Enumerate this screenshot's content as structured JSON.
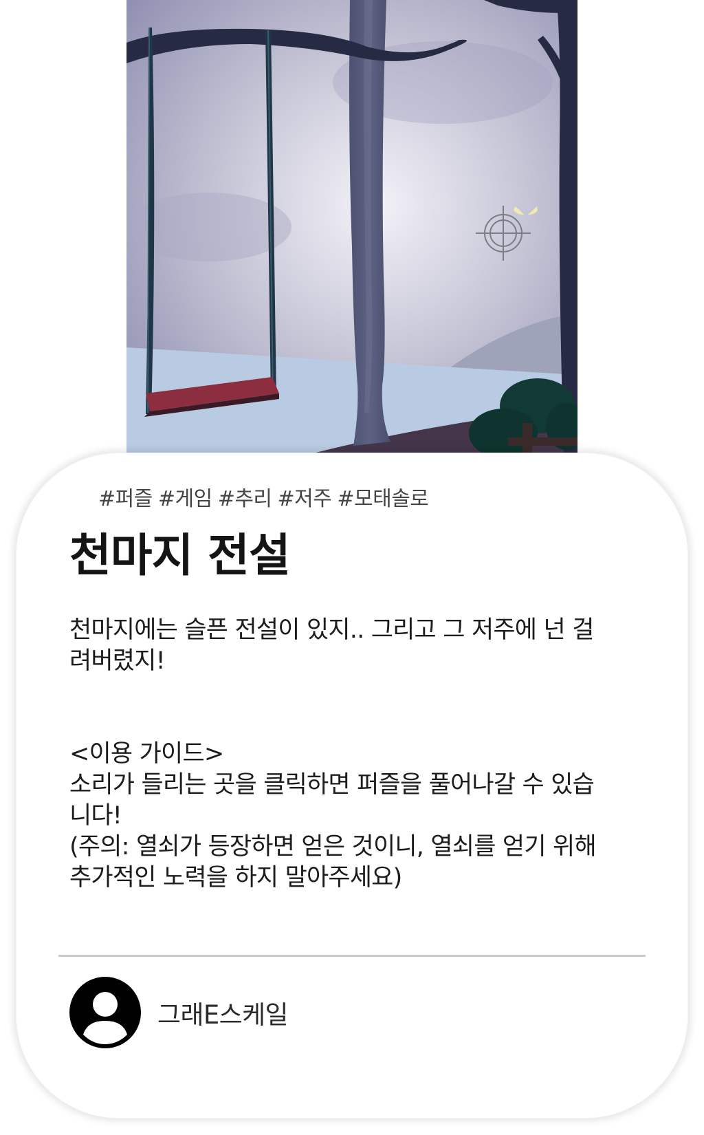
{
  "game": {
    "scene_icons": [
      "swing-icon",
      "tree-icon",
      "crosshair-icon",
      "glowing-eyes-icon"
    ]
  },
  "post": {
    "tags": [
      "#퍼즐",
      "#게임",
      "#추리",
      "#저주",
      "#모태솔로"
    ],
    "title": "천마지 전설",
    "description": "천마지에는 슬픈 전설이 있지.. 그리고 그 저주에 넌 걸려버렸지!",
    "guide": {
      "heading": "<이용 가이드>",
      "line1": "소리가 들리는 곳을 클릭하면 퍼즐을 풀어나갈 수 있습니다!",
      "line2": "(주의: 열쇠가 등장하면 얻은 것이니, 열쇠를 얻기 위해 추가적인 노력을 하지 말아주세요)"
    },
    "author": {
      "name": "그래E스케일",
      "avatar_icon": "user-avatar-icon"
    }
  },
  "colors": {
    "swing_seat": "#8c2e3f",
    "tree": "#5a5f7d",
    "sky": "#b4b2cc",
    "lake": "#b9cbe2"
  }
}
